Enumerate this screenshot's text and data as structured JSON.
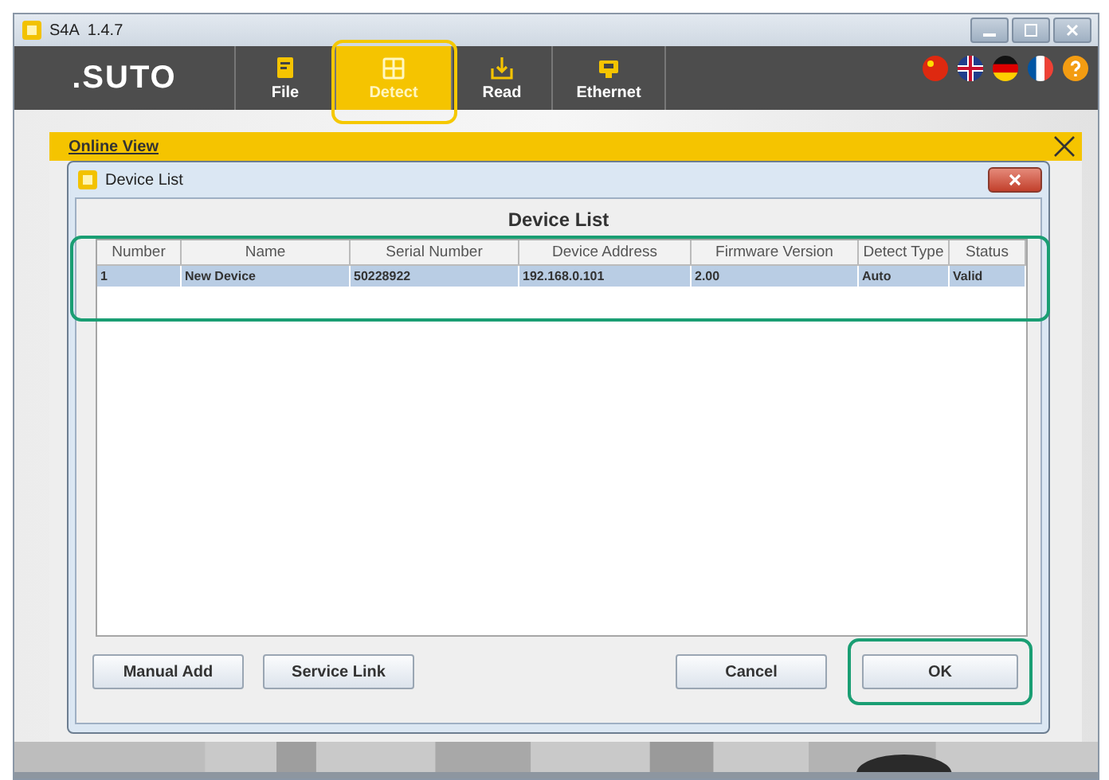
{
  "window": {
    "title": "S4A  1.4.7"
  },
  "toolbar": {
    "logo": ".SUTO",
    "tabs": [
      {
        "label": "File",
        "selected": false,
        "highlighted": false
      },
      {
        "label": "Detect",
        "selected": true,
        "highlighted": true
      },
      {
        "label": "Read",
        "selected": false,
        "highlighted": false
      },
      {
        "label": "Ethernet",
        "selected": false,
        "highlighted": false
      }
    ]
  },
  "online_view": {
    "title": "Online View"
  },
  "dialog": {
    "title": "Device List",
    "heading": "Device List",
    "table": {
      "highlighted": true,
      "columns": [
        "Number",
        "Name",
        "Serial Number",
        "Device Address",
        "Firmware Version",
        "Detect Type",
        "Status"
      ],
      "rows": [
        {
          "selected": true,
          "cells": [
            "1",
            "New Device",
            "50228922",
            "192.168.0.101",
            "2.00",
            "Auto",
            "Valid"
          ]
        }
      ]
    },
    "buttons_left": [
      {
        "label": "Manual Add",
        "highlighted": false
      },
      {
        "label": "Service Link",
        "highlighted": false
      }
    ],
    "buttons_right": [
      {
        "label": "Cancel",
        "highlighted": false
      },
      {
        "label": "OK",
        "highlighted": true
      }
    ]
  }
}
